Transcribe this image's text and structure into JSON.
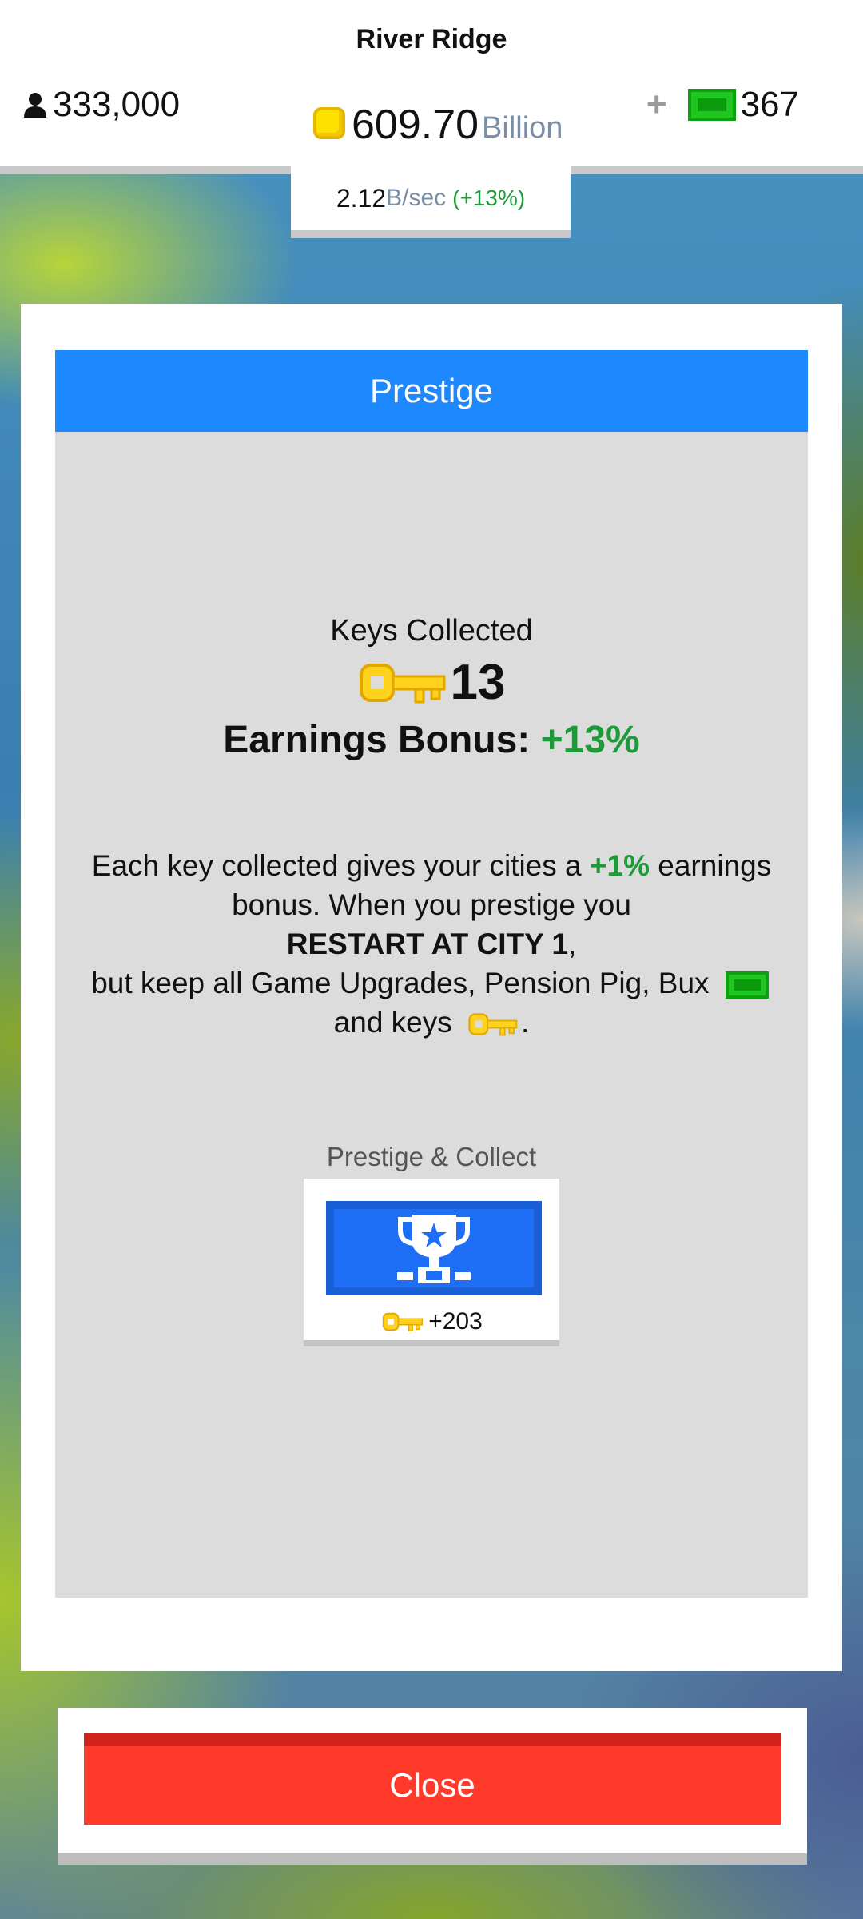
{
  "header": {
    "city_name": "River Ridge",
    "population": "333,000",
    "money_value": "609.70",
    "money_unit": "Billion",
    "rate_value": "2.12",
    "rate_unit": "B/sec",
    "rate_bonus": "(+13%)",
    "bux_plus": "+",
    "bux_count": "367"
  },
  "modal": {
    "title": "Prestige",
    "keys_label": "Keys Collected",
    "keys_count": "13",
    "bonus_label": "Earnings Bonus:",
    "bonus_value": "+13%",
    "desc_1": "Each key collected gives your cities a",
    "desc_pct": "+1%",
    "desc_2": "earnings bonus. When you prestige you",
    "desc_restart": "RESTART AT CITY 1",
    "desc_comma": ",",
    "desc_3": "but keep all Game Upgrades, Pension Pig, Bux",
    "desc_4": "and keys",
    "desc_period": ".",
    "prestige_label": "Prestige & Collect",
    "prestige_reward": "+203"
  },
  "footer": {
    "close_label": "Close"
  },
  "icons": {
    "population": "person-icon",
    "money": "coin-icon",
    "bux": "bux-cash-icon",
    "key": "key-icon",
    "prestige": "trophy-icon"
  },
  "colors": {
    "header_blue": "#1e88ff",
    "button_blue": "#1e6ff5",
    "close_red": "#ff3a2a",
    "bonus_green": "#1e9a3a",
    "key_gold": "#ffd21e"
  }
}
